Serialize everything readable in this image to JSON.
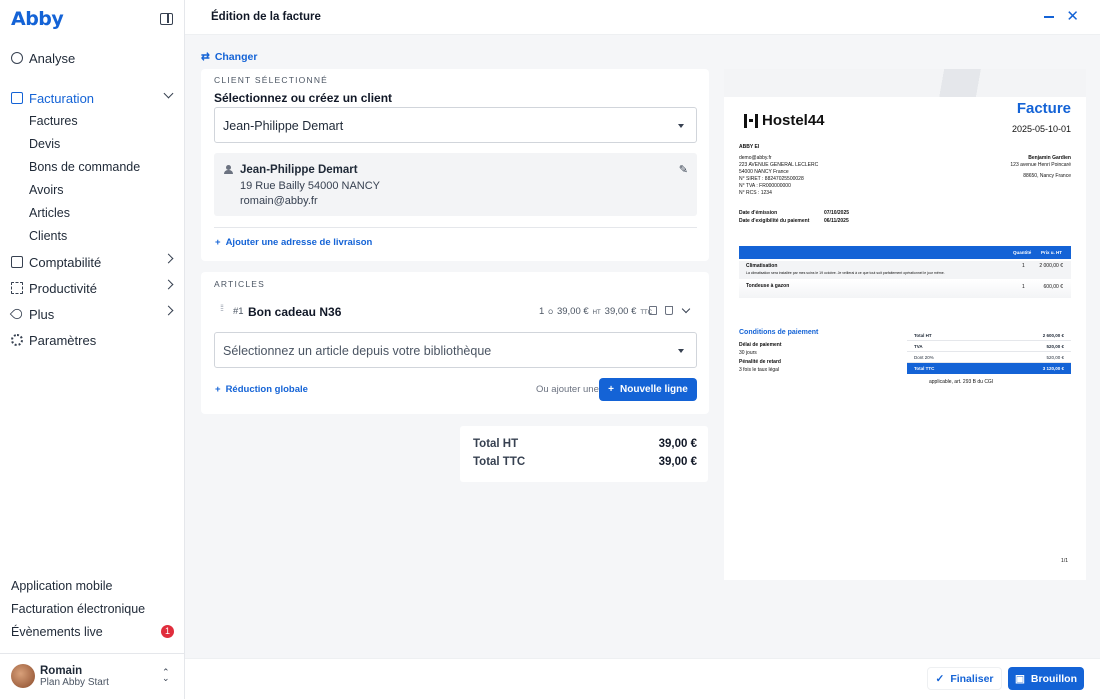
{
  "app": {
    "logo": "Abby"
  },
  "sidebar": {
    "items": [
      {
        "label": "Analyse"
      },
      {
        "label": "Facturation"
      },
      {
        "label": "Comptabilité"
      },
      {
        "label": "Productivité"
      },
      {
        "label": "Plus"
      },
      {
        "label": "Paramètres"
      }
    ],
    "sub_items": [
      "Factures",
      "Devis",
      "Bons de commande",
      "Avoirs",
      "Articles",
      "Clients"
    ],
    "bottom_links": [
      "Application mobile",
      "Facturation électronique",
      "Évènements live"
    ],
    "events_badge": "1",
    "user": {
      "name": "Romain",
      "plan": "Plan Abby Start"
    }
  },
  "header": {
    "title": "Édition de la facture"
  },
  "changer_label": "Changer",
  "client": {
    "section_label": "CLIENT SÉLECTIONNÉ",
    "title": "Sélectionnez ou créez un client",
    "selected": "Jean-Philippe Demart",
    "name": "Jean-Philippe Demart",
    "address": "19 Rue Bailly 54000 NANCY",
    "email": "romain@abby.fr",
    "add_delivery": "Ajouter une adresse de livraison"
  },
  "articles": {
    "section_label": "ARTICLES",
    "item": {
      "num": "#1",
      "name": "Bon cadeau N36",
      "qty": "1",
      "qty_unit": "O",
      "price_ht": "39,00 €",
      "ht_sup": "HT",
      "price_ttc": "39,00 €",
      "ttc_sup": "TTC"
    },
    "library_placeholder": "Sélectionnez un article depuis votre bibliothèque",
    "global_reduction": "Réduction globale",
    "or_add": "Ou ajouter une",
    "new_line": "Nouvelle ligne"
  },
  "totals": {
    "ht_label": "Total HT",
    "ht_value": "39,00 €",
    "ttc_label": "Total TTC",
    "ttc_value": "39,00 €"
  },
  "preview": {
    "logo_text": "Hostel44",
    "title": "Facture",
    "number": "2025-05-10-01",
    "sender": [
      "ABBY EI",
      "demo@abby.fr",
      "223 AVENUE GENERAL LECLERC",
      "54000 NANCY France",
      "N° SIRET : 88247025500028",
      "N° TVA : FR000000000",
      "N° RCS : 1234"
    ],
    "recipient": [
      "Benjamin Gardien",
      "123 avenue Henri Poincaré",
      "88650, Nancy France"
    ],
    "dates": [
      {
        "label": "Date d'émission",
        "value": "07/10/2025"
      },
      {
        "label": "Date d'exigibilité du paiement",
        "value": "06/11/2025"
      }
    ],
    "table_head": {
      "qty": "Quantité",
      "price": "Prix u. HT"
    },
    "rows": [
      {
        "name": "Climatisation",
        "desc": "La climatisation sera installée par mes soins le 19 octobre. Je veillerai à ce que tout soit parfaitement opérationnel le jour même.",
        "qty": "1",
        "price": "2 000,00 €"
      },
      {
        "name": "Tondeuse à gazon",
        "desc": "",
        "qty": "1",
        "price": "600,00 €"
      }
    ],
    "conditions_title": "Conditions de paiement",
    "conditions": [
      "Délai de paiement",
      "30 jours",
      "Pénalité de retard",
      "3 fois le taux légal"
    ],
    "totals": [
      {
        "label": "Total HT",
        "value": "2 600,00 €"
      },
      {
        "label": "TVA",
        "value": "520,00 €"
      },
      {
        "label": "Dont 20%",
        "value": "520,00 €"
      },
      {
        "label": "Total TTC",
        "value": "3 120,00 €"
      }
    ],
    "vat_note": "applicable, art. 293 B du CGI",
    "page": "1/1"
  },
  "footer": {
    "finaliser": "Finaliser",
    "brouillon": "Brouillon"
  },
  "colors": {
    "accent": "#1463d6",
    "badge": "#e02d3c"
  }
}
